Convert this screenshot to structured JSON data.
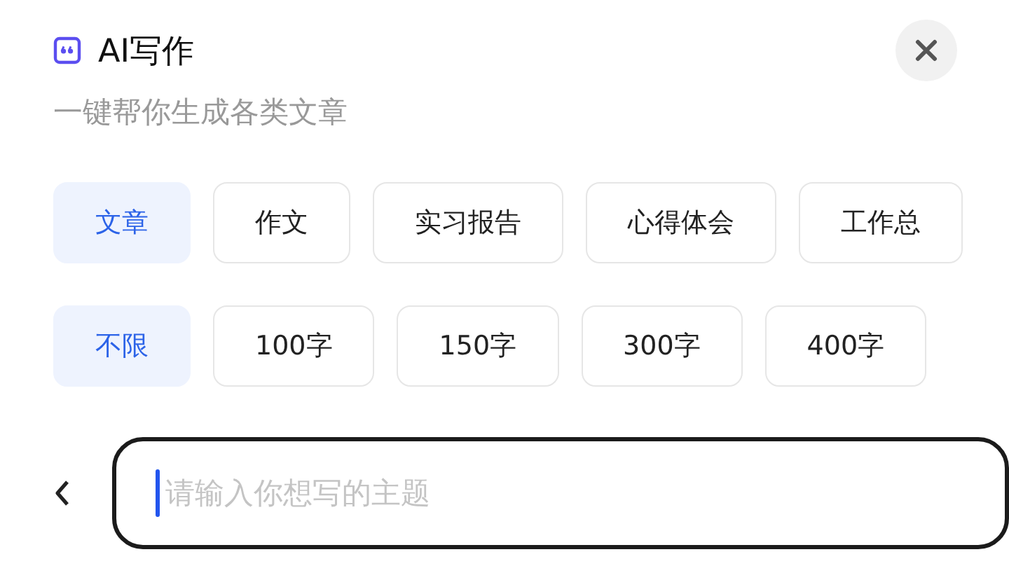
{
  "header": {
    "title": "AI写作",
    "subtitle": "一键帮你生成各类文章"
  },
  "type_options": [
    {
      "label": "文章",
      "selected": true
    },
    {
      "label": "作文",
      "selected": false
    },
    {
      "label": "实习报告",
      "selected": false
    },
    {
      "label": "心得体会",
      "selected": false
    },
    {
      "label": "工作总",
      "selected": false
    }
  ],
  "length_options": [
    {
      "label": "不限",
      "selected": true
    },
    {
      "label": "100字",
      "selected": false
    },
    {
      "label": "150字",
      "selected": false
    },
    {
      "label": "300字",
      "selected": false
    },
    {
      "label": "400字",
      "selected": false
    }
  ],
  "topic_input": {
    "placeholder": "请输入你想写的主题"
  }
}
